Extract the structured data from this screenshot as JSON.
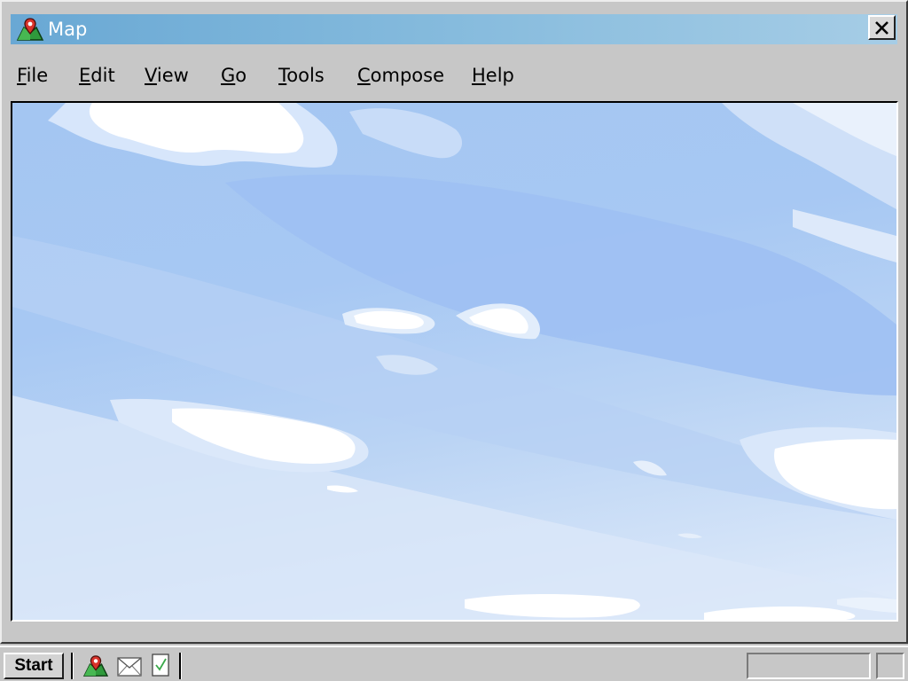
{
  "window": {
    "title": "Map",
    "icon": "map-pin-icon",
    "close_icon": "close-icon"
  },
  "menu": {
    "items": [
      {
        "first": "F",
        "rest": "ile"
      },
      {
        "first": "E",
        "rest": "dit"
      },
      {
        "first": "V",
        "rest": "iew"
      },
      {
        "first": "G",
        "rest": "o"
      },
      {
        "first": "T",
        "rest": "ools"
      },
      {
        "first": "C",
        "rest": "ompose"
      },
      {
        "first": "H",
        "rest": "elp"
      }
    ]
  },
  "map": {
    "content": "sky-with-clouds"
  },
  "taskbar": {
    "start_label": "Start",
    "quicklaunch": [
      "map-pin-icon",
      "mail-icon",
      "checkbox-icon"
    ]
  },
  "colors": {
    "titlebar_start": "#69a8d4",
    "titlebar_end": "#a6cde6",
    "sky": "#a4c6f2",
    "chrome": "#c7c7c7"
  }
}
